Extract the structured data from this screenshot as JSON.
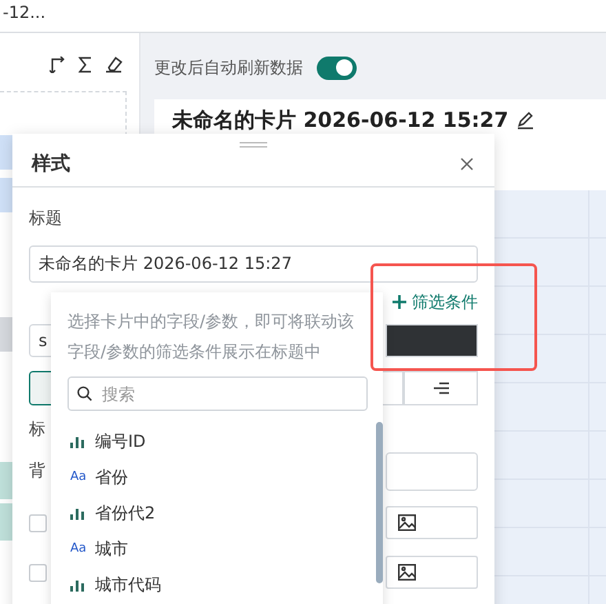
{
  "header": {
    "title_fragment": "-12..."
  },
  "sidebar": {
    "items": [
      {
        "kind": "row",
        "selected": true
      },
      {
        "kind": "row",
        "selected": true
      },
      {
        "kind": "row",
        "selected": false
      },
      {
        "kind": "tag"
      },
      {
        "kind": "tag"
      }
    ]
  },
  "auto_refresh": {
    "label": "更改后自动刷新数据",
    "on": true
  },
  "card": {
    "title": "未命名的卡片 2026-06-12 15:27"
  },
  "style_panel": {
    "title": "样式",
    "title_label": "标题",
    "title_value": "未命名的卡片 2026-06-12 15:27",
    "add_filter": "筛选条件",
    "font_value": "s",
    "section_label": "标",
    "background_label": "背",
    "checkboxes": [
      {
        "checked": false
      },
      {
        "checked": false
      }
    ]
  },
  "field_picker": {
    "hint": "选择卡片中的字段/参数，即可将联动该字段/参数的筛选条件展示在标题中",
    "search_placeholder": "搜索",
    "fields": [
      {
        "name": "编号ID",
        "kind": "measure"
      },
      {
        "name": "省份",
        "kind": "text",
        "icon_text": "Aa"
      },
      {
        "name": "省份代2",
        "kind": "measure"
      },
      {
        "name": "城市",
        "kind": "text",
        "icon_text": "Aa"
      },
      {
        "name": "城市代码",
        "kind": "measure"
      }
    ]
  }
}
